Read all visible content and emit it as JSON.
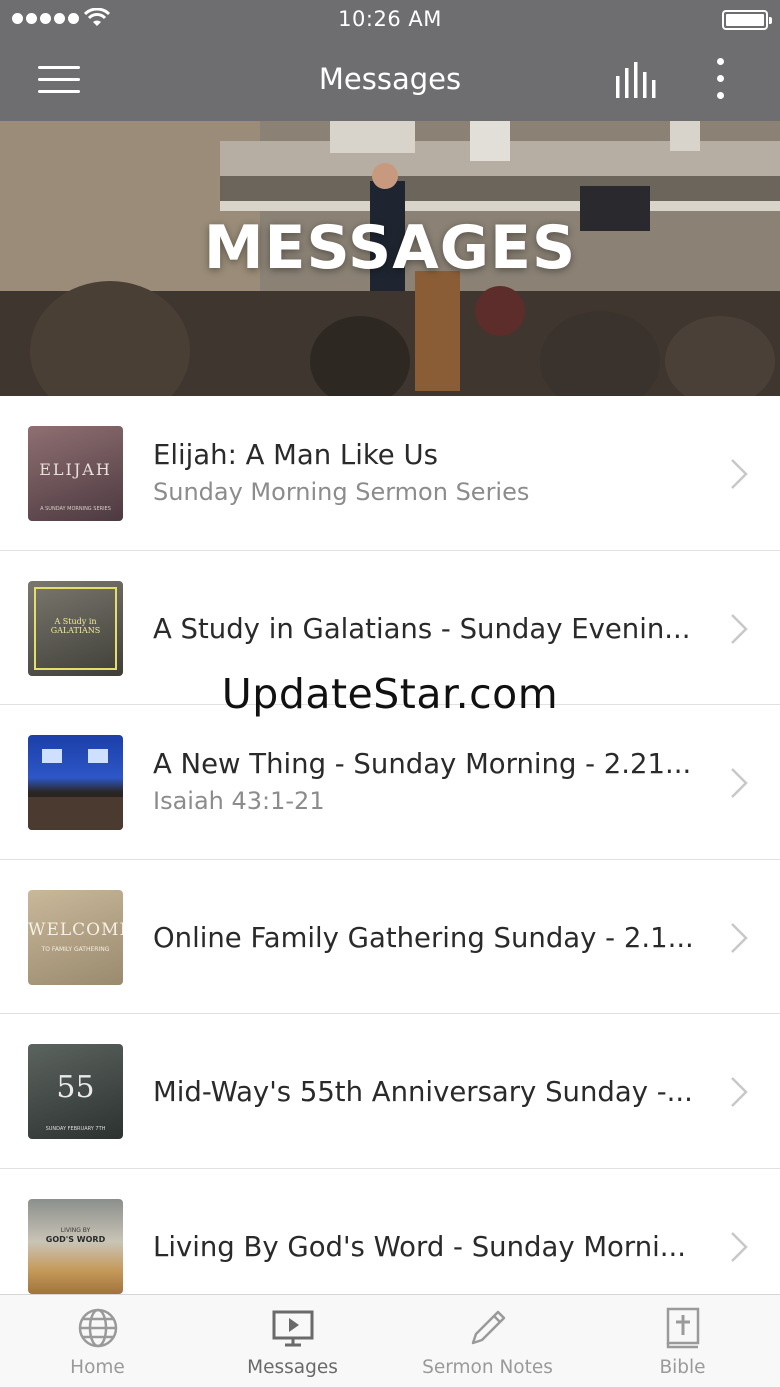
{
  "status_bar": {
    "time": "10:26 AM"
  },
  "nav": {
    "title": "Messages"
  },
  "hero": {
    "title": "MESSAGES"
  },
  "messages": [
    {
      "title": "Elijah: A Man Like Us",
      "subtitle": "Sunday Morning Sermon Series",
      "thumb_text": "ELIJAH",
      "thumb_small": "A SUNDAY MORNING SERIES"
    },
    {
      "title": "A Study in Galatians - Sunday Evenin...",
      "subtitle": "",
      "thumb_text": "A Study in GALATIANS",
      "thumb_small": ""
    },
    {
      "title": "A New Thing - Sunday Morning - 2.21...",
      "subtitle": "Isaiah 43:1-21",
      "thumb_text": "",
      "thumb_small": ""
    },
    {
      "title": "Online Family Gathering Sunday - 2.1...",
      "subtitle": "",
      "thumb_text": "WELCOME",
      "thumb_small": "TO FAMILY GATHERING"
    },
    {
      "title": "Mid-Way's 55th Anniversary Sunday -...",
      "subtitle": "",
      "thumb_text": "55",
      "thumb_small": "SUNDAY FEBRUARY 7TH"
    },
    {
      "title": "Living By God's Word - Sunday Morni...",
      "subtitle": "",
      "thumb_text": "GOD'S WORD",
      "thumb_small": "LIVING BY"
    }
  ],
  "watermark": "UpdateStar.com",
  "tabs": [
    {
      "label": "Home",
      "icon": "globe-icon",
      "active": false
    },
    {
      "label": "Messages",
      "icon": "tv-play-icon",
      "active": true
    },
    {
      "label": "Sermon Notes",
      "icon": "pencil-icon",
      "active": false
    },
    {
      "label": "Bible",
      "icon": "bible-icon",
      "active": false
    }
  ],
  "colors": {
    "nav_bg": "#6e6e70",
    "tab_inactive": "#9a9a9a",
    "tab_active": "#6a6a6a",
    "chevron": "#c7c7cc"
  }
}
